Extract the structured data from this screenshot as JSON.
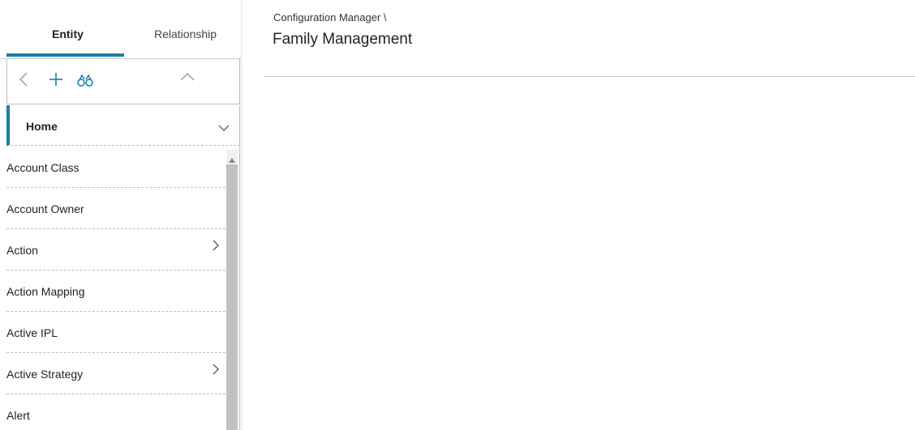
{
  "left_panel": {
    "tabs": [
      {
        "label": "Entity",
        "active": true
      },
      {
        "label": "Relationship",
        "active": false
      }
    ],
    "toolbar": {
      "icons": [
        "chevron-left-icon",
        "plus-icon",
        "binoculars-icon",
        "chevron-up-icon"
      ]
    },
    "home": {
      "label": "Home",
      "icon": "chevron-down-icon"
    },
    "items": [
      {
        "label": "Account Class",
        "has_children": false
      },
      {
        "label": "Account Owner",
        "has_children": false
      },
      {
        "label": "Action",
        "has_children": true
      },
      {
        "label": "Action Mapping",
        "has_children": false
      },
      {
        "label": "Active IPL",
        "has_children": false
      },
      {
        "label": "Active Strategy",
        "has_children": true
      },
      {
        "label": "Alert",
        "has_children": false
      }
    ]
  },
  "main": {
    "breadcrumb": "Configuration Manager \\",
    "title": "Family Management"
  },
  "colors": {
    "accent": "#1a7fa6",
    "muted_icon": "#9aa0a6",
    "divider": "#cfcfcf"
  }
}
